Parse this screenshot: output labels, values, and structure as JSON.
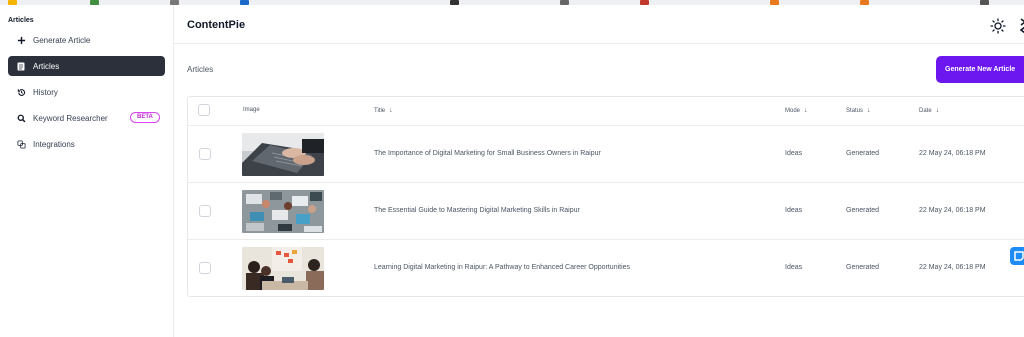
{
  "sidebar": {
    "heading": "Articles",
    "items": [
      {
        "label": "Generate Article",
        "icon": "plus-icon",
        "active": false
      },
      {
        "label": "Articles",
        "icon": "document-icon",
        "active": true
      },
      {
        "label": "History",
        "icon": "history-icon",
        "active": false
      },
      {
        "label": "Keyword Researcher",
        "icon": "search-icon",
        "active": false,
        "badge": "BETA"
      },
      {
        "label": "Integrations",
        "icon": "integrations-icon",
        "active": false
      }
    ]
  },
  "header": {
    "brand": "ContentPie",
    "theme_icon": "sun-icon"
  },
  "main": {
    "title": "Articles",
    "generate_button": "Generate New Article"
  },
  "table": {
    "columns": {
      "image": "Image",
      "title": "Title",
      "mode": "Mode",
      "status": "Status",
      "date": "Date"
    },
    "sort_arrow": "↓",
    "rows": [
      {
        "title": "The Importance of Digital Marketing for Small Business Owners in Raipur",
        "mode": "Ideas",
        "status": "Generated",
        "date": "22 May 24, 06:18 PM"
      },
      {
        "title": "The Essential Guide to Mastering Digital Marketing Skills in Raipur",
        "mode": "Ideas",
        "status": "Generated",
        "date": "22 May 24, 06:18 PM"
      },
      {
        "title": "Learning Digital Marketing in Raipur: A Pathway to Enhanced Career Opportunities",
        "mode": "Ideas",
        "status": "Generated",
        "date": "22 May 24, 06:18 PM"
      }
    ]
  },
  "colors": {
    "accent": "#6d17f0",
    "active_nav": "#2b303b",
    "beta_badge": "#d946ef"
  }
}
